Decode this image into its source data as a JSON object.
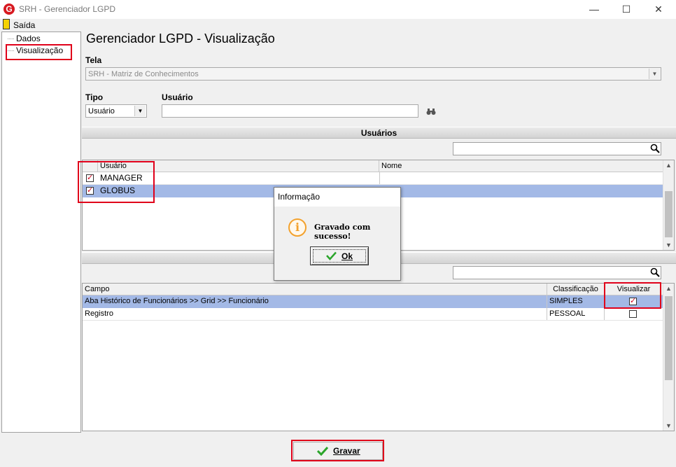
{
  "window": {
    "title": "SRH - Gerenciador LGPD",
    "app_icon_letter": "G"
  },
  "menu": {
    "exit_label": "Saída"
  },
  "tree": {
    "items": [
      {
        "label": "Dados"
      },
      {
        "label": "Visualização"
      }
    ]
  },
  "page": {
    "title": "Gerenciador LGPD - Visualização"
  },
  "form": {
    "tela_label": "Tela",
    "tela_value": "SRH - Matriz de Conhecimentos",
    "tipo_label": "Tipo",
    "tipo_value": "Usuário",
    "usuario_label": "Usuário",
    "usuario_value": ""
  },
  "users_section": {
    "title": "Usuários",
    "search_value": "",
    "columns": [
      "Usuário",
      "Nome"
    ],
    "rows": [
      {
        "checked": true,
        "usuario": "MANAGER",
        "nome": ""
      },
      {
        "checked": true,
        "usuario": "GLOBUS",
        "nome": ""
      }
    ]
  },
  "fields_section": {
    "search_value": "",
    "columns": [
      "Campo",
      "Classificação",
      "Visualizar"
    ],
    "rows": [
      {
        "campo": "Aba Histórico de Funcionários >> Grid >> Funcionário",
        "classificacao": "SIMPLES",
        "visualizar": true
      },
      {
        "campo": "Registro",
        "classificacao": "PESSOAL",
        "visualizar": false
      }
    ]
  },
  "dialog": {
    "title": "Informação",
    "message": "Gravado com sucesso!",
    "ok_label": "Ok"
  },
  "footer": {
    "save_label": "Gravar"
  },
  "colors": {
    "annotation_red": "#e0001a",
    "selection": "#a3b9e6",
    "info_orange": "#f3a12c",
    "check_green": "#2aa52a"
  }
}
